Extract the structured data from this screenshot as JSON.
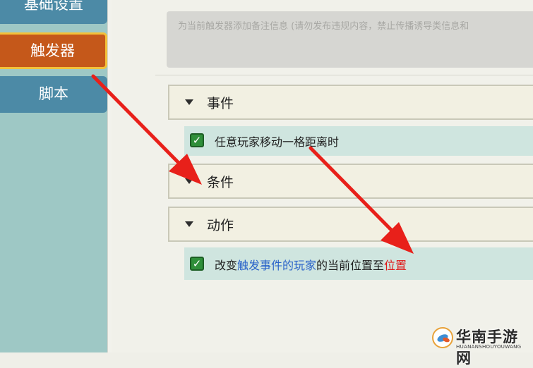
{
  "sidebar": {
    "tabs": [
      {
        "label": "基础设置"
      },
      {
        "label": "触发器"
      },
      {
        "label": "脚本"
      }
    ]
  },
  "notes": {
    "placeholder": "为当前触发器添加备注信息 (请勿发布违规内容，禁止传播诱导类信息和"
  },
  "sections": {
    "events": {
      "title": "事件"
    },
    "conditions": {
      "title": "条件"
    },
    "actions": {
      "title": "动作"
    }
  },
  "event_item": {
    "checked": true,
    "text": "任意玩家移动一格距离时"
  },
  "action_item": {
    "checked": true,
    "prefix": "改变",
    "target": "触发事件的玩家",
    "middle": "的当前位置至",
    "value": "位置"
  },
  "colors": {
    "trigger_tab": "#c5581a",
    "sidebar_tab": "#4c8aa6",
    "check_green": "#2f8f3a",
    "highlight_blue": "#2a63c9",
    "highlight_red": "#e01818",
    "arrow_red": "#e8201a"
  },
  "watermark": {
    "title": "华南手游网",
    "subtitle": "HUANANSHOUYOUWANG"
  }
}
